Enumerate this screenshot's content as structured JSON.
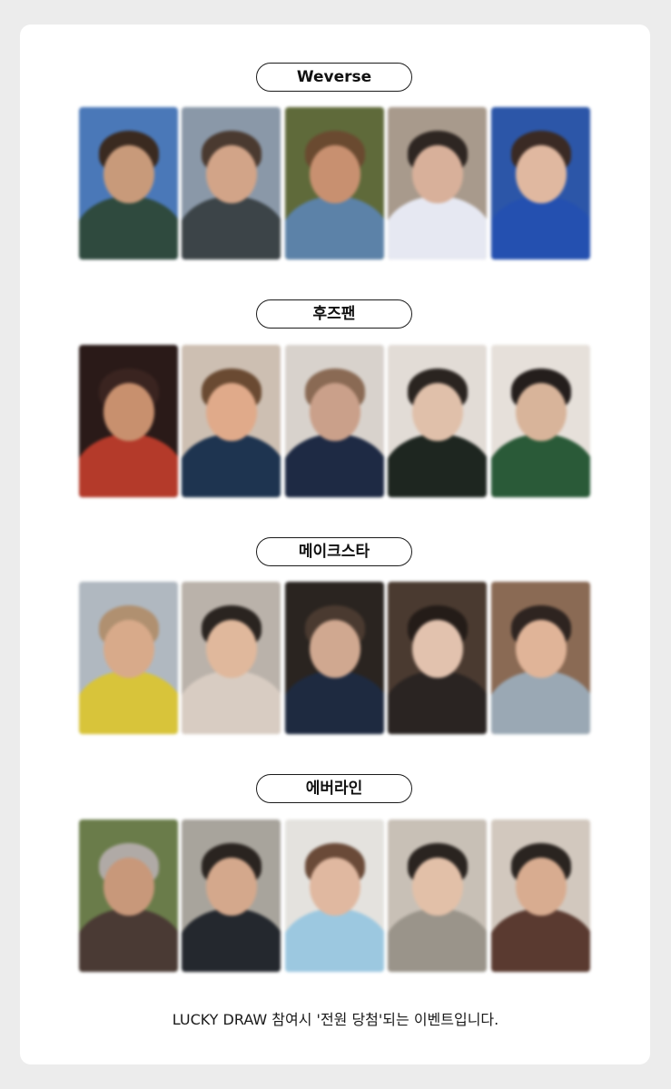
{
  "sections": [
    {
      "label": "Weverse",
      "photos": [
        {
          "bg": "#4a78b8",
          "body": "#2f4a3e",
          "skin": "#c89a7a",
          "hair": "#3a2a20"
        },
        {
          "bg": "#8a98a8",
          "body": "#3c4448",
          "skin": "#d2a488",
          "hair": "#4a3a30"
        },
        {
          "bg": "#5f6a3a",
          "body": "#5c82a8",
          "skin": "#c89070",
          "hair": "#6a4a30"
        },
        {
          "bg": "#a89a8c",
          "body": "#e6e8f2",
          "skin": "#d8b09a",
          "hair": "#2e2622"
        },
        {
          "bg": "#2c56a8",
          "body": "#2450b0",
          "skin": "#e0b8a0",
          "hair": "#3a2a24"
        }
      ]
    },
    {
      "label": "후즈팬",
      "photos": [
        {
          "bg": "#2a1a18",
          "body": "#b43a2a",
          "skin": "#c8906e",
          "hair": "#3a2420"
        },
        {
          "bg": "#cdbfb2",
          "body": "#1e3450",
          "skin": "#e0aa8a",
          "hair": "#6a4a32"
        },
        {
          "bg": "#d8d2cc",
          "body": "#1e2a44",
          "skin": "#caa08a",
          "hair": "#8a6a54"
        },
        {
          "bg": "#e2dcd6",
          "body": "#1e2620",
          "skin": "#e0c0aa",
          "hair": "#2a2420"
        },
        {
          "bg": "#e6e0da",
          "body": "#2a5a38",
          "skin": "#d8b49a",
          "hair": "#241e1c"
        }
      ]
    },
    {
      "label": "메이크스타",
      "photos": [
        {
          "bg": "#b0b8c0",
          "body": "#d8c43a",
          "skin": "#d8aa8a",
          "hair": "#b09070"
        },
        {
          "bg": "#bab2aa",
          "body": "#d8ccc2",
          "skin": "#e0b89c",
          "hair": "#2a2420"
        },
        {
          "bg": "#2a2420",
          "body": "#1e2a40",
          "skin": "#d0a890",
          "hair": "#4a3a30"
        },
        {
          "bg": "#4a3a30",
          "body": "#2a2422",
          "skin": "#e2c2ae",
          "hair": "#241c18"
        },
        {
          "bg": "#8a6a54",
          "body": "#9aa8b4",
          "skin": "#e0b498",
          "hair": "#2e2420"
        }
      ]
    },
    {
      "label": "에버라인",
      "photos": [
        {
          "bg": "#6a7c4a",
          "body": "#4a3a34",
          "skin": "#c8987a",
          "hair": "#b0aaa6"
        },
        {
          "bg": "#a8a49c",
          "body": "#24282e",
          "skin": "#d4a88c",
          "hair": "#2a2420"
        },
        {
          "bg": "#e4e2de",
          "body": "#9cc8e0",
          "skin": "#e0b8a0",
          "hair": "#6a4a38"
        },
        {
          "bg": "#c8c0b6",
          "body": "#9a948a",
          "skin": "#e2c0a8",
          "hair": "#2a2420"
        },
        {
          "bg": "#d2c8be",
          "body": "#5a3a30",
          "skin": "#d8ac90",
          "hair": "#2a2420"
        }
      ]
    }
  ],
  "footer": "LUCKY DRAW 참여시 '전원 당첨'되는 이벤트입니다."
}
